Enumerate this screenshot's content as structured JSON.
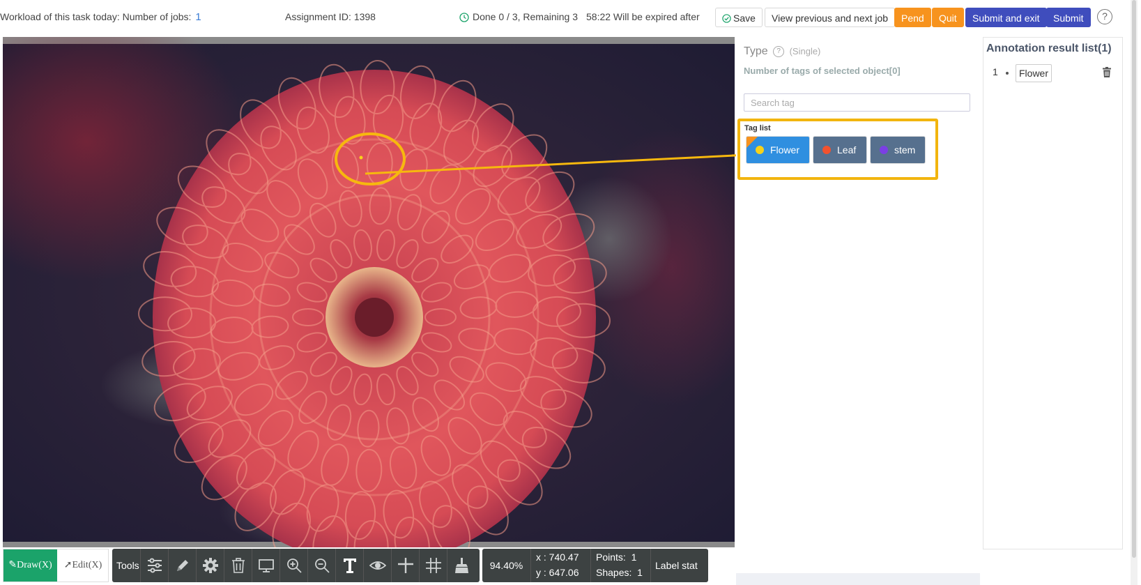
{
  "header": {
    "workload_label": "Workload of this task today: Number of jobs:",
    "workload_count": "1",
    "assignment": "Assignment ID: 1398",
    "progress": "Done 0 / 3, Remaining 3",
    "expire": "58:22 Will be expired after",
    "buttons": {
      "save": "Save",
      "view": "View previous and next job",
      "pend": "Pend",
      "quit": "Quit",
      "submit_exit": "Submit and exit",
      "submit": "Submit"
    },
    "help": "?"
  },
  "colors": {
    "accent_orange": "#f7931e",
    "accent_indigo": "#3f4dbd",
    "highlight_yellow": "#f2b50e",
    "draw_green": "#1ba36a"
  },
  "sidebar": {
    "type_label": "Type",
    "type_help": "?",
    "type_mode": "(Single)",
    "selected_count": "Number of tags of selected object[0]",
    "search_placeholder": "Search tag",
    "tag_list_label": "Tag list",
    "tags": [
      {
        "label": "Flower",
        "dot_color": "#f7d21a",
        "selected": true
      },
      {
        "label": "Leaf",
        "dot_color": "#f2522e",
        "selected": false
      },
      {
        "label": "stem",
        "dot_color": "#7b3fe4",
        "selected": false
      }
    ]
  },
  "results": {
    "title": "Annotation result list(1)",
    "items": [
      {
        "index": "1",
        "label": "Flower"
      }
    ]
  },
  "toolbar": {
    "draw": "Draw(X)",
    "edit": "Edit(X)",
    "tools_label": "Tools",
    "icons": [
      "sliders-icon",
      "pencil-icon",
      "gear-icon",
      "trash-icon",
      "monitor-icon",
      "zoom-in-icon",
      "zoom-out-icon",
      "text-icon",
      "eye-icon",
      "crosshair-icon",
      "grid-icon",
      "broom-icon"
    ]
  },
  "status": {
    "zoom": "94.40%",
    "x": "x : 740.47",
    "y": "y : 647.06",
    "points": "Points:  1",
    "shapes": "Shapes:  1",
    "label_stat": "Label stat"
  }
}
